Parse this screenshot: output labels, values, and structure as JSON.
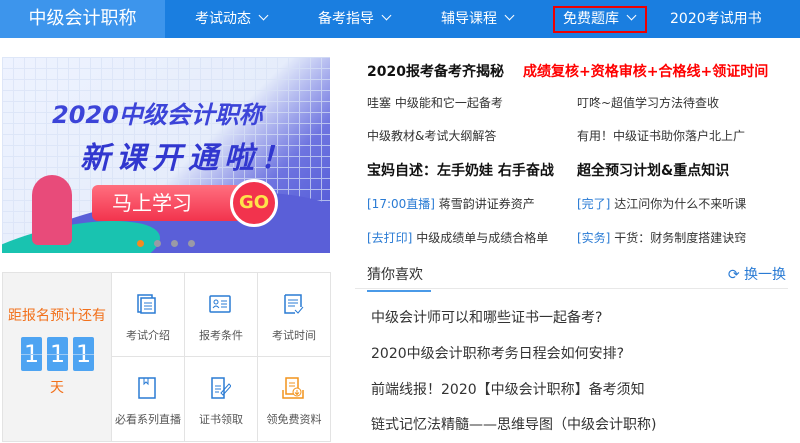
{
  "nav": {
    "logo": "中级会计职称",
    "items": [
      {
        "label": "考试动态"
      },
      {
        "label": "备考指导"
      },
      {
        "label": "辅导课程"
      },
      {
        "label": "免费题库",
        "highlighted": true
      },
      {
        "label": "2020考试用书"
      }
    ]
  },
  "banner": {
    "line1": "2020中级会计职称",
    "line2": "新课开通啦！",
    "button": "马上学习",
    "go": "GO",
    "active_slide": 1,
    "slides": 4
  },
  "news": {
    "headline1": "2020报考备考齐揭秘",
    "headline1_red": "成绩复核+资格审核+合格线+领证时间",
    "links1": [
      "哇塞 中级能和它一起备考",
      "叮咚~超值学习方法待查收",
      "中级教材&考试大纲解答",
      "有用！中级证书助你落户北上广"
    ],
    "headline2a": "宝妈自述：左手奶娃 右手奋战",
    "headline2b": "超全预习计划&重点知识",
    "links2": [
      {
        "tag": "[17:00直播]",
        "text": "蒋雪韵讲证券资产"
      },
      {
        "tag": "[完了]",
        "text": "达江问你为什么不来听课"
      },
      {
        "tag": "[去打印]",
        "text": "中级成绩单与成绩合格单"
      },
      {
        "tag": "[实务]",
        "text": "干货：财务制度搭建诀窍"
      }
    ]
  },
  "guess": {
    "tab": "猜你喜欢",
    "refresh": "换一换",
    "items": [
      "中级会计师可以和哪些证书一起备考?",
      "2020中级会计职称考务日程会如何安排?",
      "前端线报！2020【中级会计职称】备考须知",
      "链式记忆法精髓——思维导图（中级会计职称)"
    ]
  },
  "countdown": {
    "label": "距报名预计还有",
    "digits": [
      "1",
      "1",
      "1"
    ],
    "unit": "天"
  },
  "quick": [
    {
      "label": "考试介绍",
      "icon": "document-copy-icon"
    },
    {
      "label": "报考条件",
      "icon": "id-card-icon"
    },
    {
      "label": "考试时间",
      "icon": "checklist-icon"
    },
    {
      "label": "必看系列直播",
      "icon": "book-icon"
    },
    {
      "label": "证书领取",
      "icon": "certificate-edit-icon"
    },
    {
      "label": "领免费资料",
      "icon": "download-file-icon"
    }
  ],
  "colors": {
    "nav": "#1a7ee0",
    "accent": "#2a7bd4",
    "orange": "#f2711c",
    "red": "#ff0000"
  }
}
